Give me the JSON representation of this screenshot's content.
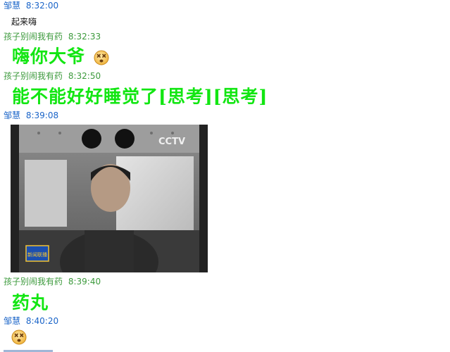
{
  "messages": [
    {
      "sender": "邹慧",
      "time": "8:32:00",
      "text": "起来嗨"
    },
    {
      "sender": "孩子别闹我有药",
      "time": "8:32:33",
      "text": "嗨你大爷",
      "emoji": "dizzy-face-icon"
    },
    {
      "sender": "孩子别闹我有药",
      "time": "8:32:50",
      "text": "能不能好好睡觉了[思考][思考]"
    },
    {
      "sender": "邹慧",
      "time": "8:39:08",
      "image": {
        "watermark": "CCTV",
        "caption": "新闻联播"
      }
    },
    {
      "sender": "孩子别闹我有药",
      "time": "8:39:40",
      "text": "药丸"
    },
    {
      "sender": "邹慧",
      "time": "8:40:20",
      "emoji": "dizzy-face-icon"
    }
  ],
  "colors": {
    "self_header": "#1a64c8",
    "other_header": "#3c9a3c",
    "big_text": "#12e612",
    "background": "#ffffff"
  }
}
